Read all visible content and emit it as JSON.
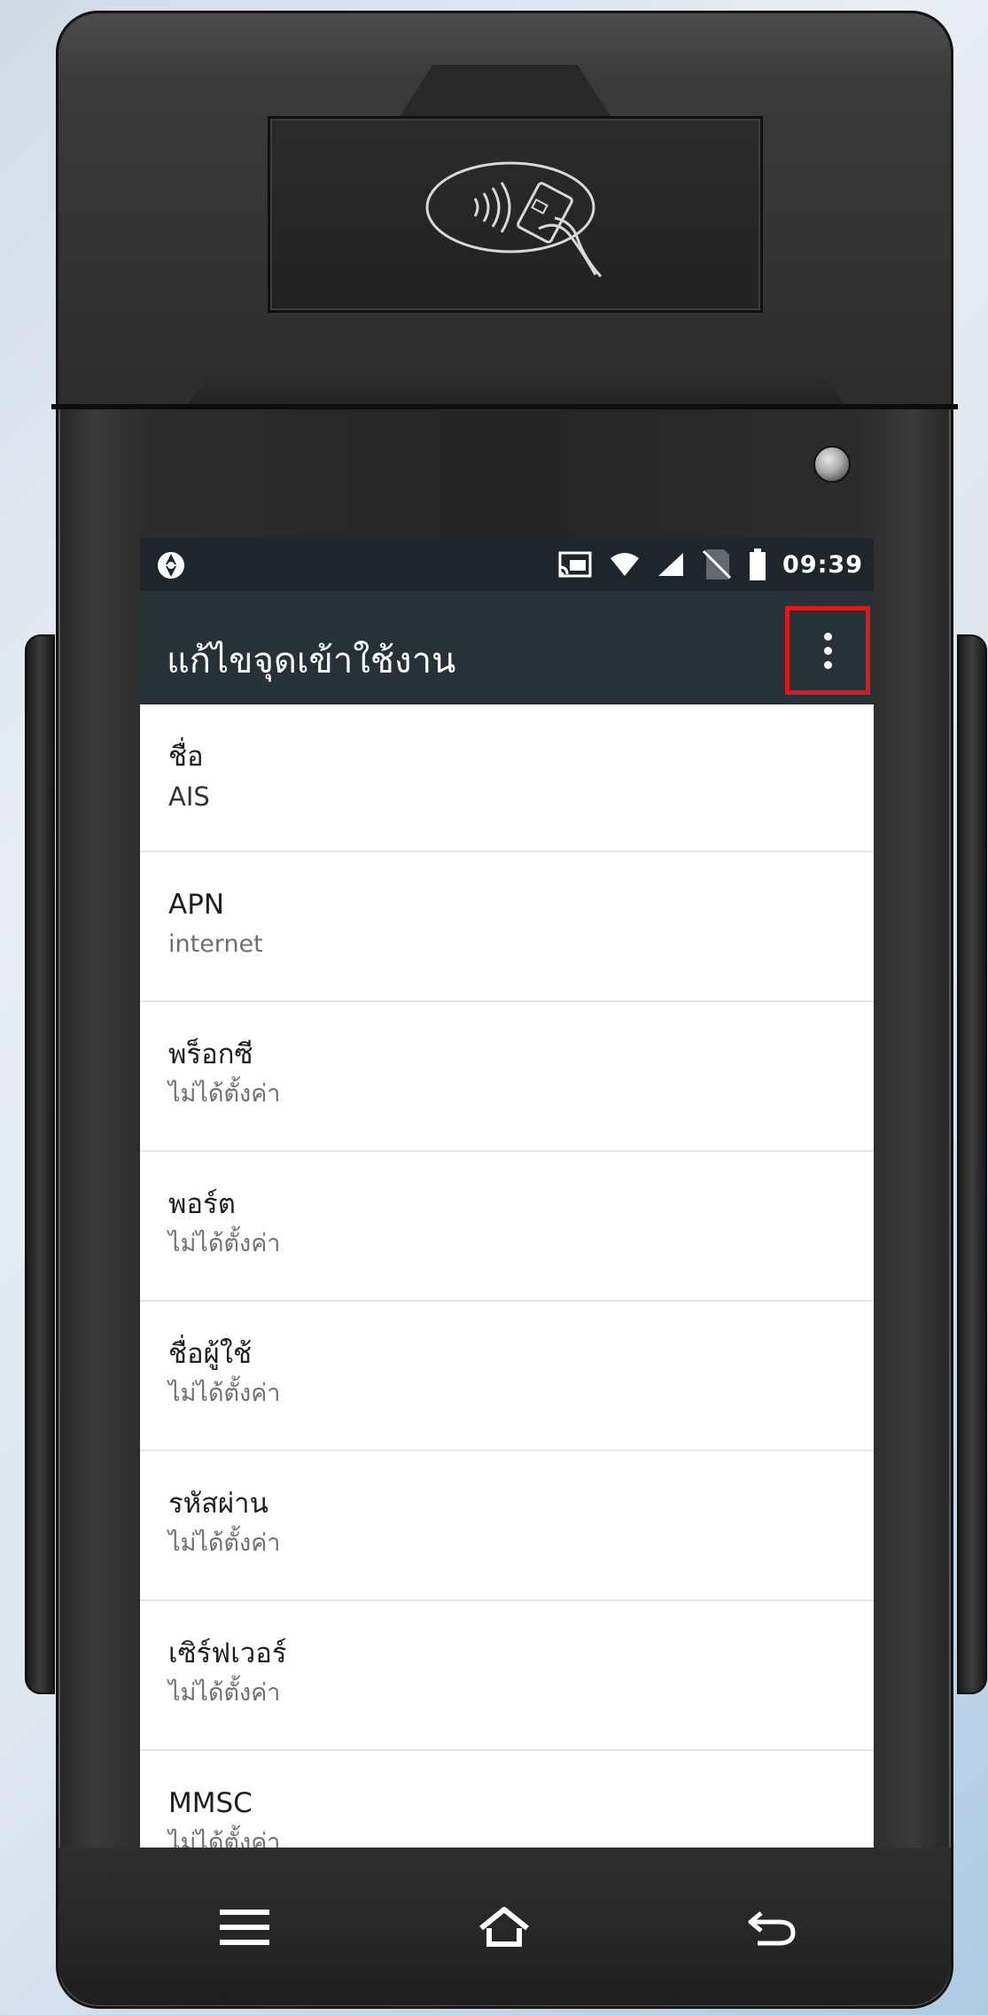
{
  "status_bar": {
    "time": "09:39",
    "icons": [
      "sync-icon",
      "cast-icon",
      "wifi-icon",
      "signal-icon",
      "no-sim-icon",
      "battery-icon"
    ]
  },
  "app_bar": {
    "title": "แก้ไขจุดเข้าใช้งาน",
    "menu_icon": "more-vert-icon",
    "highlight_color": "#e0181b"
  },
  "settings": [
    {
      "title": "ชื่อ",
      "summary": "AIS"
    },
    {
      "title": "APN",
      "summary": "internet"
    },
    {
      "title": "พร็อกซี",
      "summary": "ไม่ได้ตั้งค่า"
    },
    {
      "title": "พอร์ต",
      "summary": "ไม่ได้ตั้งค่า"
    },
    {
      "title": "ชื่อผู้ใช้",
      "summary": "ไม่ได้ตั้งค่า"
    },
    {
      "title": "รหัสผ่าน",
      "summary": "ไม่ได้ตั้งค่า"
    },
    {
      "title": "เซิร์ฟเวอร์",
      "summary": "ไม่ได้ตั้งค่า"
    },
    {
      "title": "MMSC",
      "summary": "ไม่ได้ตั้งค่า"
    }
  ],
  "nav_bar": {
    "icons": [
      "menu-icon",
      "home-icon",
      "back-icon"
    ]
  },
  "colors": {
    "status_bar": "#1e262b",
    "app_bar": "#253238",
    "list_background": "#ffffff"
  }
}
